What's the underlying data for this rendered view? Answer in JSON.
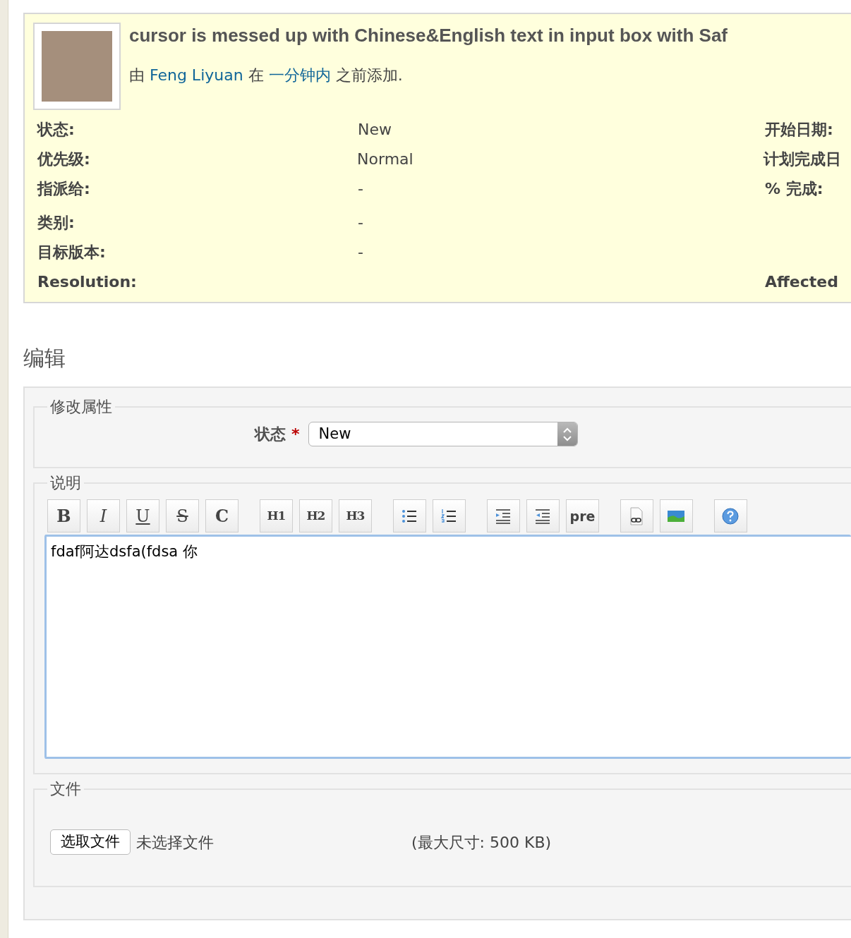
{
  "issue": {
    "title": "cursor is messed up with Chinese&English text in input box with Saf",
    "byline": {
      "prefix": "由",
      "author": "Feng Liyuan",
      "middle": "在",
      "time": "一分钟内",
      "suffix": "之前添加."
    },
    "attributes": [
      {
        "label": "状态:",
        "value": "New",
        "side_label": "开始日期:"
      },
      {
        "label": "优先级:",
        "value": "Normal",
        "side_label": "计划完成日"
      },
      {
        "label": "指派给:",
        "value": "-",
        "side_label": "% 完成:"
      },
      {
        "label": "类别:",
        "value": "-"
      },
      {
        "label": "目标版本:",
        "value": "-"
      },
      {
        "label": "Resolution:",
        "side_label": "Affected"
      }
    ]
  },
  "edit": {
    "heading": "编辑",
    "properties": {
      "legend": "修改属性",
      "status_label": "状态",
      "required_mark": "*",
      "status_value": "New"
    },
    "description": {
      "legend": "说明",
      "toolbar": [
        [
          {
            "kind": "bold",
            "label": "B"
          },
          {
            "kind": "italic",
            "label": "I"
          },
          {
            "kind": "underline",
            "label": "U"
          },
          {
            "kind": "strike",
            "label": "S"
          },
          {
            "kind": "code",
            "label": "C"
          }
        ],
        [
          {
            "kind": "heading",
            "label": "H1"
          },
          {
            "kind": "heading",
            "label": "H2"
          },
          {
            "kind": "heading",
            "label": "H3"
          }
        ],
        [
          {
            "kind": "bullets"
          },
          {
            "kind": "numbers"
          }
        ],
        [
          {
            "kind": "indent"
          },
          {
            "kind": "outdent"
          },
          {
            "kind": "pre",
            "label": "pre"
          }
        ],
        [
          {
            "kind": "link"
          },
          {
            "kind": "image"
          }
        ],
        [
          {
            "kind": "help"
          }
        ]
      ],
      "text": "fdaf阿达dsfa(fdsa 你"
    },
    "files": {
      "legend": "文件",
      "button": "选取文件",
      "status": "未选择文件",
      "limit": "(最大尺寸: 500 KB)"
    }
  }
}
